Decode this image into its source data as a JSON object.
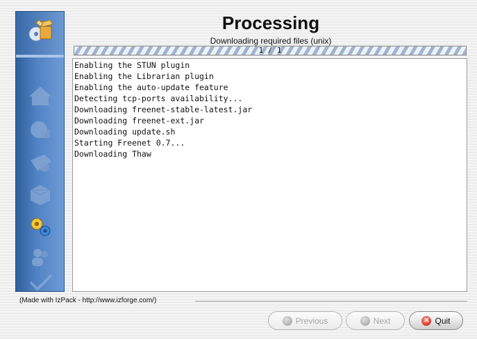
{
  "header": {
    "title": "Processing",
    "subtitle": "Downloading required files (unix)"
  },
  "progress": {
    "label": "1 / 1",
    "fraction": 1.0
  },
  "log": {
    "lines": [
      "Enabling the STUN plugin",
      "Enabling the Librarian plugin",
      "Enabling the auto-update feature",
      "Detecting tcp-ports availability...",
      "Downloading freenet-stable-latest.jar",
      "Downloading freenet-ext.jar",
      "Downloading update.sh",
      "Starting Freenet 0.7...",
      "Downloading Thaw"
    ]
  },
  "sidebar": {
    "steps": [
      {
        "icon": "install-package-icon",
        "state": "header"
      },
      {
        "icon": "home-icon",
        "state": "inactive"
      },
      {
        "icon": "network-icon",
        "state": "inactive"
      },
      {
        "icon": "folder-icon",
        "state": "inactive"
      },
      {
        "icon": "package-icon",
        "state": "inactive"
      },
      {
        "icon": "gears-icon",
        "state": "active"
      },
      {
        "icon": "users-icon",
        "state": "inactive"
      },
      {
        "icon": "checkmark-icon",
        "state": "inactive"
      }
    ]
  },
  "footer": {
    "credit": "(Made with IzPack - http://www.izforge.com/)",
    "previous_label": "Previous",
    "next_label": "Next",
    "quit_label": "Quit"
  },
  "colors": {
    "sidebar": "#4f7fbf",
    "quit_icon": "#d0261a",
    "progress_stripe": "#9fb4d1"
  }
}
